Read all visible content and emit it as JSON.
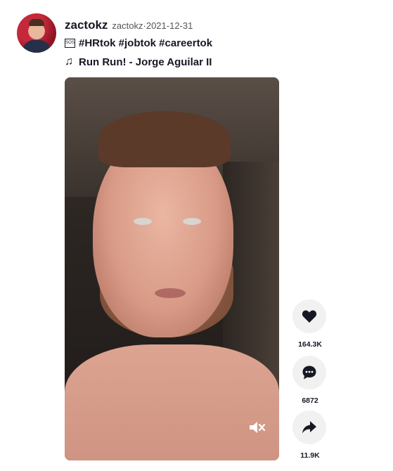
{
  "post": {
    "username": "zactokz",
    "nickname": "zactokz",
    "separator": " · ",
    "date": "2021-12-31",
    "caption_icon": "🆘",
    "caption": "#HRtok #jobtok #careertok",
    "music": "Run Run! - Jorge Aguilar II"
  },
  "actions": {
    "likes": "164.3K",
    "comments": "6872",
    "shares": "11.9K"
  },
  "icons": {
    "like": "heart-icon",
    "comment": "comment-icon",
    "share": "share-icon",
    "mute": "speaker-muted-icon",
    "music": "music-note-icon"
  }
}
